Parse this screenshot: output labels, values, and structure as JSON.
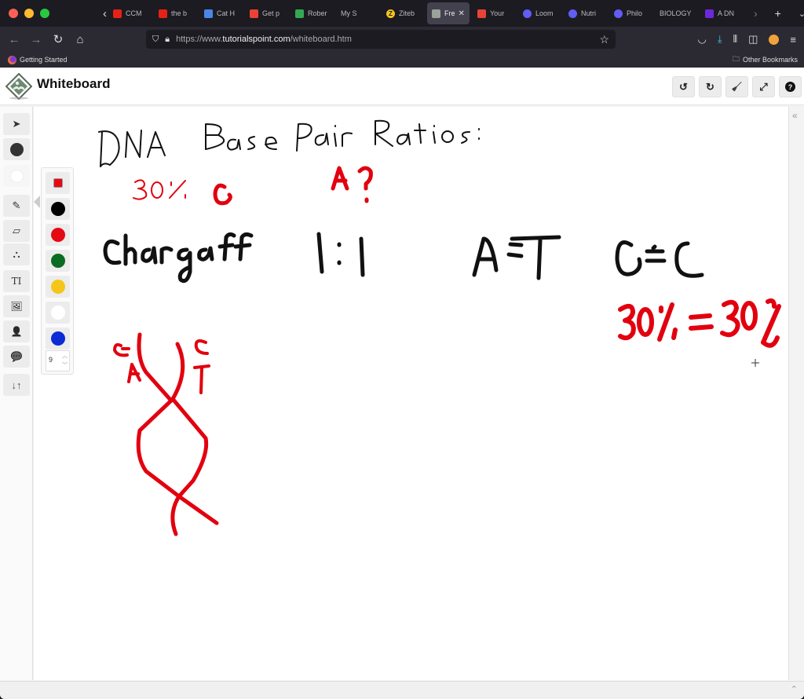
{
  "browser": {
    "tabs": [
      {
        "label": "CCM",
        "favicon": "youtube-icon",
        "color": "#e62117"
      },
      {
        "label": "the b",
        "favicon": "youtube-icon",
        "color": "#e62117"
      },
      {
        "label": "Cat H",
        "favicon": "google-docs-icon",
        "color": "#4a86e8"
      },
      {
        "label": "Get p",
        "favicon": "gmail-icon",
        "color": "#ea4335"
      },
      {
        "label": "Rober",
        "favicon": "google-drive-icon",
        "color": "#34a853"
      },
      {
        "label": "My S",
        "favicon": "",
        "color": ""
      },
      {
        "label": "Ziteb",
        "favicon": "zitebooks-icon",
        "color": "#f5c518"
      },
      {
        "label": "Fre",
        "favicon": "tutorialspoint-icon",
        "color": "#9aa39a",
        "active": true
      },
      {
        "label": "Your",
        "favicon": "gmail-icon",
        "color": "#ea4335"
      },
      {
        "label": "Loom",
        "favicon": "loom-icon",
        "color": "#625df5"
      },
      {
        "label": "Nutri",
        "favicon": "loom-icon",
        "color": "#625df5"
      },
      {
        "label": "Philo",
        "favicon": "loom-icon",
        "color": "#625df5"
      },
      {
        "label": "BIOLOGY",
        "favicon": "",
        "color": ""
      },
      {
        "label": "A DN",
        "favicon": "brainly-icon",
        "color": "#6d28d9"
      }
    ],
    "url_prefix": "https://www.",
    "url_host": "tutorialspoint.com",
    "url_path": "/whiteboard.htm",
    "bookmark_getting_started": "Getting Started",
    "bookmark_other": "Other Bookmarks"
  },
  "app": {
    "title": "Whiteboard",
    "header_buttons": [
      {
        "name": "undo-button",
        "icon": "undo-icon",
        "glyph": "↺"
      },
      {
        "name": "redo-button",
        "icon": "redo-icon",
        "glyph": "↻"
      },
      {
        "name": "clear-button",
        "icon": "broom-icon",
        "glyph": "🧹"
      },
      {
        "name": "fullscreen-button",
        "icon": "expand-icon",
        "glyph": "⤢"
      },
      {
        "name": "help-button",
        "icon": "help-icon",
        "glyph": "?"
      }
    ],
    "tools": [
      {
        "name": "select-tool",
        "icon": "cursor-icon",
        "glyph": "➤"
      },
      {
        "name": "fill-color-tool",
        "icon": "dark-circle-icon",
        "glyph": "●"
      },
      {
        "name": "background-color-tool",
        "icon": "white-circle-icon",
        "glyph": "●"
      },
      {
        "name": "pencil-tool",
        "icon": "pencil-icon",
        "glyph": "✎"
      },
      {
        "name": "eraser-tool",
        "icon": "eraser-icon",
        "glyph": "▱"
      },
      {
        "name": "shapes-tool",
        "icon": "shapes-icon",
        "glyph": "⛬"
      },
      {
        "name": "text-tool",
        "icon": "text-icon",
        "glyph": "TI"
      },
      {
        "name": "image-tool",
        "icon": "image-icon",
        "glyph": "🖼"
      },
      {
        "name": "presenter-tool",
        "icon": "presenter-icon",
        "glyph": "👤"
      },
      {
        "name": "chat-tool",
        "icon": "chat-icon",
        "glyph": "💬"
      },
      {
        "name": "sort-tool",
        "icon": "arrows-up-down-icon",
        "glyph": "↓↑"
      }
    ],
    "palette": {
      "selected_color": "#e50914",
      "colors": [
        "#000000",
        "#e50914",
        "#0a6b22",
        "#f5c518",
        "#ffffff",
        "#0a2bd6"
      ],
      "brush_size": "9"
    }
  },
  "canvas_text": {
    "title": "DNA Base Pair Ratios:",
    "given": "30% G",
    "question": "A?",
    "rule_name": "Chargaff",
    "ratio": "1:1",
    "pair_at": "A=T",
    "pair_gc": "G=C",
    "equation": "30% = 30%",
    "helix_left_labels": [
      "G",
      "A"
    ],
    "helix_right_labels": [
      "C",
      "T"
    ]
  },
  "colors": {
    "ink_black": "#111111",
    "ink_red": "#e2000f"
  }
}
